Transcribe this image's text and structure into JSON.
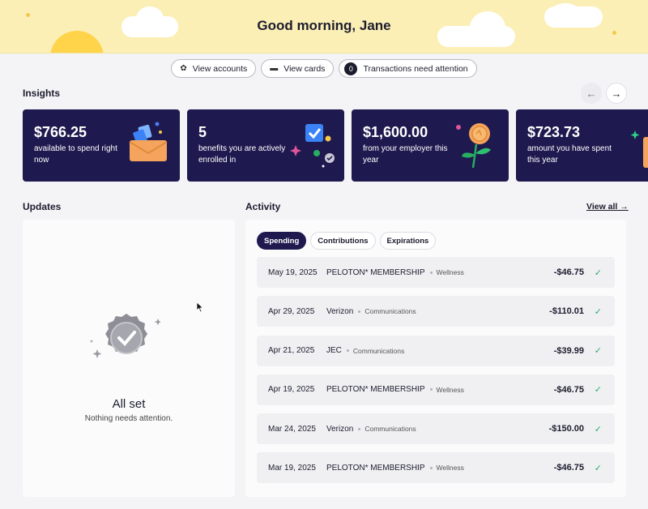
{
  "header": {
    "greeting": "Good morning, Jane"
  },
  "pills": [
    {
      "label": "View accounts",
      "icon": "plant-icon"
    },
    {
      "label": "View cards",
      "icon": "card-icon"
    },
    {
      "label": "Transactions need attention",
      "badge": "0"
    }
  ],
  "insights": {
    "title": "Insights",
    "cards": [
      {
        "amount": "$766.25",
        "desc": "available to spend right now",
        "icon": "envelope-icon"
      },
      {
        "amount": "5",
        "desc": "benefits you are actively enrolled in",
        "icon": "checkbox-icon"
      },
      {
        "amount": "$1,600.00",
        "desc": "from your employer this year",
        "icon": "coin-flower-icon"
      },
      {
        "amount": "$723.73",
        "desc": "amount you have spent this year",
        "icon": "shopping-bag-icon"
      }
    ]
  },
  "updates": {
    "title": "Updates",
    "empty_title": "All set",
    "empty_sub": "Nothing needs attention."
  },
  "activity": {
    "title": "Activity",
    "view_all": "View all →",
    "tabs": [
      "Spending",
      "Contributions",
      "Expirations"
    ],
    "rows": [
      {
        "date": "May 19, 2025",
        "merchant": "PELOTON* MEMBERSHIP",
        "category": "Wellness",
        "amount": "-$46.75"
      },
      {
        "date": "Apr 29, 2025",
        "merchant": "Verizon",
        "category": "Communications",
        "amount": "-$110.01"
      },
      {
        "date": "Apr 21, 2025",
        "merchant": "JEC",
        "category": "Communications",
        "amount": "-$39.99"
      },
      {
        "date": "Apr 19, 2025",
        "merchant": "PELOTON* MEMBERSHIP",
        "category": "Wellness",
        "amount": "-$46.75"
      },
      {
        "date": "Mar 24, 2025",
        "merchant": "Verizon",
        "category": "Communications",
        "amount": "-$150.00"
      },
      {
        "date": "Mar 19, 2025",
        "merchant": "PELOTON* MEMBERSHIP",
        "category": "Wellness",
        "amount": "-$46.75"
      }
    ]
  },
  "colors": {
    "brand": "#1e1a4f",
    "banner": "#fbefb6",
    "success": "#27ae60"
  }
}
